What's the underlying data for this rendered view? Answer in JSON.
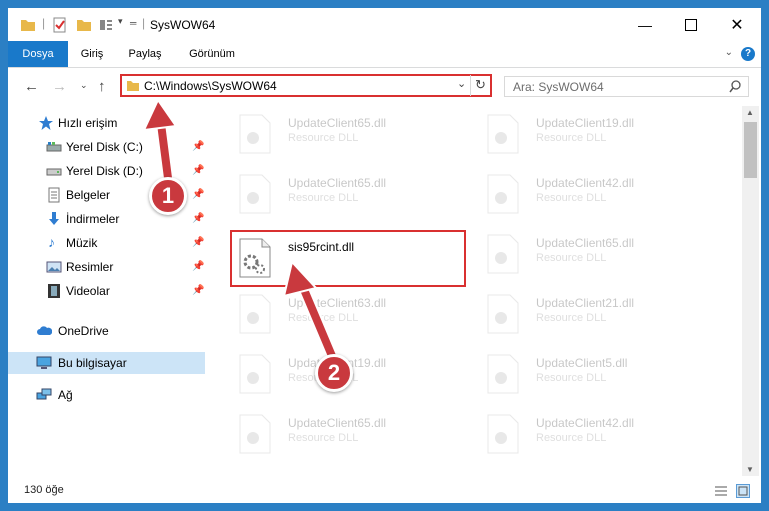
{
  "window": {
    "title": "SysWOW64"
  },
  "ribbon": {
    "tabs": [
      {
        "label": "Dosya",
        "active": true
      },
      {
        "label": "Giriş",
        "active": false
      },
      {
        "label": "Paylaş",
        "active": false
      },
      {
        "label": "Görünüm",
        "active": false
      }
    ],
    "help_label": "?"
  },
  "address": {
    "path": "C:\\Windows\\SysWOW64"
  },
  "search": {
    "placeholder": "Ara: SysWOW64"
  },
  "sidebar": {
    "quick_access": "Hızlı erişim",
    "items": [
      {
        "label": "Yerel Disk (C:)",
        "icon": "drive-icon"
      },
      {
        "label": "Yerel Disk (D:)",
        "icon": "drive-icon"
      },
      {
        "label": "Belgeler",
        "icon": "documents-icon"
      },
      {
        "label": "İndirmeler",
        "icon": "download-icon"
      },
      {
        "label": "Müzik",
        "icon": "music-icon"
      },
      {
        "label": "Resimler",
        "icon": "pictures-icon"
      },
      {
        "label": "Videolar",
        "icon": "videos-icon"
      }
    ],
    "onedrive": "OneDrive",
    "this_pc": "Bu bilgisayar",
    "network": "Ağ"
  },
  "files": {
    "left": [
      {
        "name": "UpdateClient65.dll",
        "type": "Resource DLL"
      },
      {
        "name": "UpdateClient65.dll",
        "type": "Resource DLL"
      },
      {
        "name": "sis95rcint.dll",
        "type": ""
      },
      {
        "name": "UpdateClient63.dll",
        "type": "Resource DLL"
      },
      {
        "name": "UpdateClient19.dll",
        "type": "Resource DLL"
      },
      {
        "name": "UpdateClient65.dll",
        "type": "Resource DLL"
      }
    ],
    "right": [
      {
        "name": "UpdateClient19.dll",
        "type": "Resource DLL"
      },
      {
        "name": "UpdateClient42.dll",
        "type": "Resource DLL"
      },
      {
        "name": "UpdateClient65.dll",
        "type": "Resource DLL"
      },
      {
        "name": "UpdateClient21.dll",
        "type": "Resource DLL"
      },
      {
        "name": "UpdateClient5.dll",
        "type": "Resource DLL"
      },
      {
        "name": "UpdateClient42.dll",
        "type": "Resource DLL"
      }
    ]
  },
  "status": {
    "count": "130 öğe"
  },
  "callouts": {
    "one": "1",
    "two": "2"
  },
  "colors": {
    "accent": "#1979ca",
    "highlight": "#d93030",
    "callout": "#c9393e",
    "selected": "#cce4f7"
  }
}
